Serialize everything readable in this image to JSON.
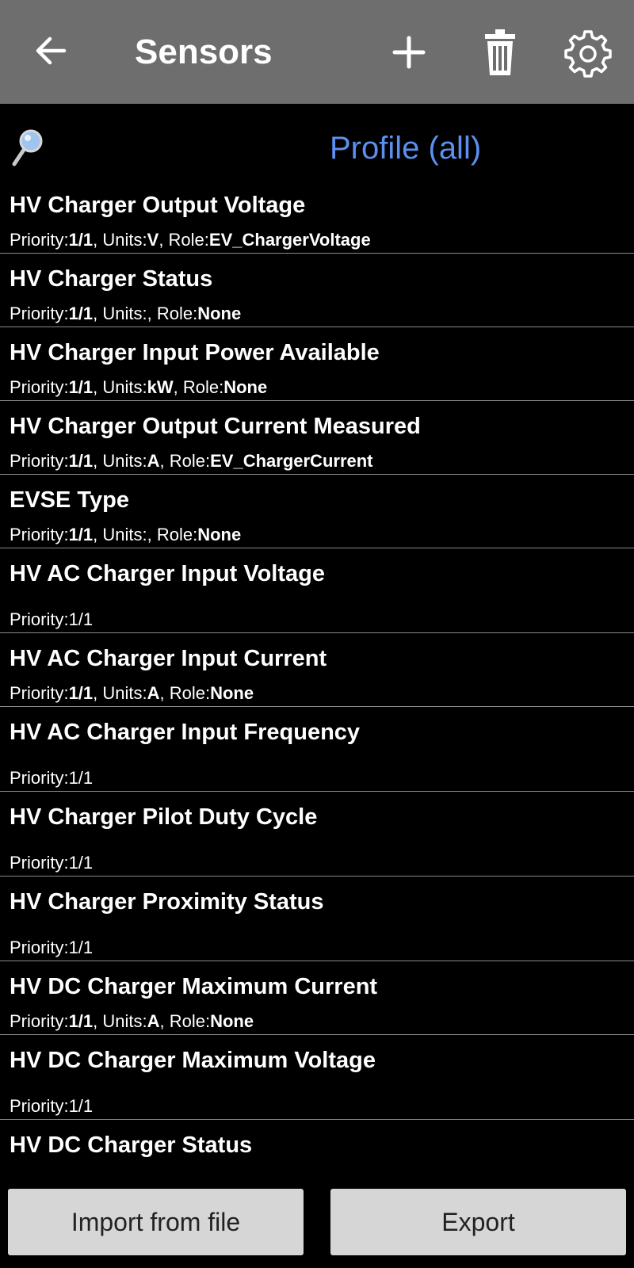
{
  "appbar": {
    "title": "Sensors",
    "icons": [
      "arrow-left-icon",
      "plus-icon",
      "trash-icon",
      "gear-icon"
    ]
  },
  "search": {
    "icon": "magnifier-icon",
    "profile_label": "Profile (all)"
  },
  "sensors": [
    {
      "name": "HV Charger Output Voltage",
      "priority": "1/1",
      "units": "V",
      "role": "EV_ChargerVoltage"
    },
    {
      "name": "HV Charger Status",
      "priority": "1/1",
      "units": "",
      "role": "None"
    },
    {
      "name": "HV Charger Input Power Available",
      "priority": "1/1",
      "units": "kW",
      "role": "None"
    },
    {
      "name": "HV Charger Output Current Measured",
      "priority": "1/1",
      "units": "A",
      "role": "EV_ChargerCurrent"
    },
    {
      "name": "EVSE Type",
      "priority": "1/1",
      "units": "",
      "role": "None"
    },
    {
      "name": "HV AC Charger Input Voltage",
      "priority": "1/1"
    },
    {
      "name": "HV AC Charger Input Current",
      "priority": "1/1",
      "units": "A",
      "role": "None"
    },
    {
      "name": "HV AC Charger Input Frequency",
      "priority": "1/1"
    },
    {
      "name": "HV Charger Pilot Duty Cycle",
      "priority": "1/1"
    },
    {
      "name": "HV Charger Proximity Status",
      "priority": "1/1"
    },
    {
      "name": "HV DC Charger Maximum Current",
      "priority": "1/1",
      "units": "A",
      "role": "None"
    },
    {
      "name": "HV DC Charger Maximum Voltage",
      "priority": "1/1"
    },
    {
      "name": "HV DC Charger Status",
      "priority": ""
    }
  ],
  "footer": {
    "import_label": "Import from file",
    "export_label": "Export"
  },
  "colors": {
    "appbar_bg": "#6e6e6e",
    "accent": "#5b8ff0",
    "button_bg": "#d6d6d6"
  }
}
